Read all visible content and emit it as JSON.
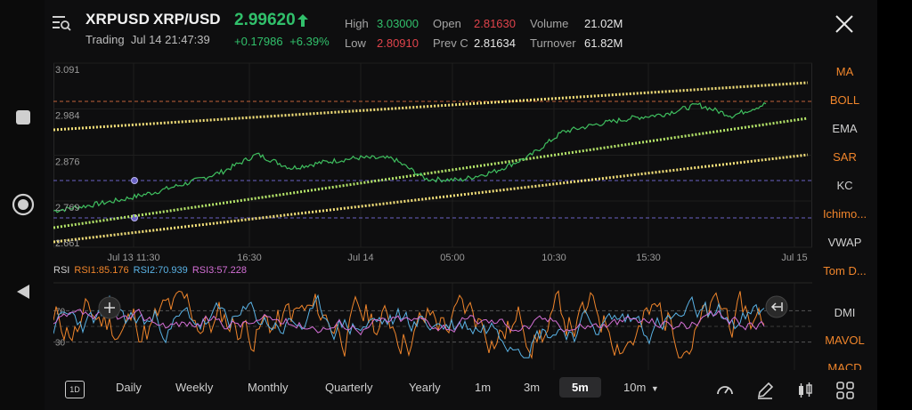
{
  "header": {
    "menu_icon": "menu-search-icon",
    "symbol": "XRPUSD",
    "pair": "XRP/USD",
    "status": "Trading",
    "datetime": "Jul 14 21:47:39",
    "price": "2.99620",
    "change": "+0.17986",
    "change_pct": "+6.39%",
    "stats": {
      "high_label": "High",
      "high": "3.03000",
      "low_label": "Low",
      "low": "2.80910",
      "open_label": "Open",
      "open": "2.81630",
      "prevc_label": "Prev C",
      "prevc": "2.81634",
      "volume_label": "Volume",
      "volume": "21.02M",
      "turnover_label": "Turnover",
      "turnover": "61.82M"
    },
    "colors": {
      "up": "#31c06b",
      "down": "#e0434b"
    }
  },
  "chart": {
    "y_ticks": [
      "3.091",
      "2.984",
      "2.876",
      "2.769",
      "2.661"
    ],
    "x_ticks": [
      "Jul 13 11:30",
      "16:30",
      "Jul 14",
      "05:00",
      "10:30",
      "15:30",
      "Jul 15"
    ],
    "rsi": {
      "title": "RSI",
      "rsi1": "RSI1:85.176",
      "rsi2": "RSI2:70.939",
      "rsi3": "RSI3:57.228",
      "level_high": "70",
      "level_low": "30",
      "colors": {
        "rsi1": "#f0852b",
        "rsi2": "#5ab3e6",
        "rsi3": "#d46fd6"
      }
    }
  },
  "chart_data": {
    "type": "line",
    "series": [
      {
        "values": [
          2.746,
          2.758,
          2.772,
          2.79,
          2.812,
          2.838,
          2.878,
          2.846,
          2.86,
          2.87,
          2.868,
          2.82,
          2.818,
          2.838,
          2.872,
          2.93,
          2.948,
          2.962,
          2.972,
          2.994,
          2.968,
          2.996
        ]
      }
    ],
    "ylim": [
      2.661,
      3.091
    ]
  },
  "indicators": [
    "MA",
    "BOLL",
    "EMA",
    "SAR",
    "KC",
    "Ichimo...",
    "VWAP",
    "Tom D...",
    "DMI",
    "MAVOL",
    "MACD"
  ],
  "indicator_colors": [
    "#f0852b",
    "#f0852b",
    "#cfcfcf",
    "#f0852b",
    "#cfcfcf",
    "#f0852b",
    "#cfcfcf",
    "#f0852b",
    "#cfcfcf",
    "#f0852b",
    "#f0852b"
  ],
  "timeframes": [
    "Daily",
    "Weekly",
    "Monthly",
    "Quarterly",
    "Yearly",
    "1m",
    "3m",
    "5m",
    "10m"
  ],
  "active_timeframe": "5m",
  "day_button": "1D",
  "tools": [
    "speedometer-icon",
    "draw-pencil-icon",
    "candlestick-icon",
    "grid-icon"
  ]
}
